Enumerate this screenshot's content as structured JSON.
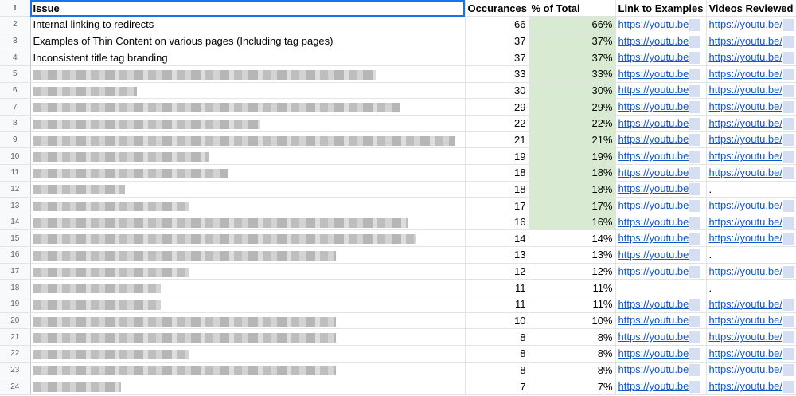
{
  "sheet": {
    "row_numbers": [
      "1",
      "2",
      "3",
      "4",
      "5",
      "6",
      "7",
      "8",
      "9",
      "10",
      "11",
      "12",
      "13",
      "14",
      "15",
      "16",
      "17",
      "18",
      "19",
      "20",
      "21",
      "22",
      "23",
      "24"
    ],
    "headers": {
      "issue": "Issue",
      "occurances": "Occurances",
      "pct": "% of Total",
      "examples": "Link to Examples",
      "videos": "Videos Reviewed"
    },
    "rows": [
      {
        "issue": "Internal linking to redirects",
        "occ": "66",
        "pct": "66%",
        "ex": "https://youtu.be",
        "vid": "https://youtu.be/"
      },
      {
        "issue": "Examples of Thin Content on various pages (Including tag pages)",
        "occ": "37",
        "pct": "37%",
        "ex": "https://youtu.be",
        "vid": "https://youtu.be/"
      },
      {
        "issue": "Inconsistent title tag branding",
        "occ": "37",
        "pct": "37%",
        "ex": "https://youtu.be",
        "vid": "https://youtu.be/"
      },
      {
        "issue": "",
        "occ": "33",
        "pct": "33%",
        "ex": "https://youtu.be",
        "vid": "https://youtu.be/"
      },
      {
        "issue": "",
        "occ": "30",
        "pct": "30%",
        "ex": "https://youtu.be",
        "vid": "https://youtu.be/"
      },
      {
        "issue": "",
        "occ": "29",
        "pct": "29%",
        "ex": "https://youtu.be",
        "vid": "https://youtu.be/"
      },
      {
        "issue": "",
        "occ": "22",
        "pct": "22%",
        "ex": "https://youtu.be",
        "vid": "https://youtu.be/"
      },
      {
        "issue": "",
        "occ": "21",
        "pct": "21%",
        "ex": "https://youtu.be",
        "vid": "https://youtu.be/"
      },
      {
        "issue": "",
        "occ": "19",
        "pct": "19%",
        "ex": "https://youtu.be",
        "vid": "https://youtu.be/"
      },
      {
        "issue": "",
        "occ": "18",
        "pct": "18%",
        "ex": "https://youtu.be",
        "vid": "https://youtu.be/"
      },
      {
        "issue": "",
        "occ": "18",
        "pct": "18%",
        "ex": "https://youtu.be",
        "vid": "."
      },
      {
        "issue": "",
        "occ": "17",
        "pct": "17%",
        "ex": "https://youtu.be",
        "vid": "https://youtu.be/"
      },
      {
        "issue": "",
        "occ": "16",
        "pct": "16%",
        "ex": "https://youtu.be",
        "vid": "https://youtu.be/"
      },
      {
        "issue": "",
        "occ": "14",
        "pct": "14%",
        "ex": "https://youtu.be",
        "vid": "https://youtu.be/"
      },
      {
        "issue": "",
        "occ": "13",
        "pct": "13%",
        "ex": "https://youtu.be",
        "vid": "."
      },
      {
        "issue": "",
        "occ": "12",
        "pct": "12%",
        "ex": "https://youtu.be",
        "vid": "https://youtu.be/"
      },
      {
        "issue": "",
        "occ": "11",
        "pct": "11%",
        "ex": "",
        "vid": "."
      },
      {
        "issue": "",
        "occ": "11",
        "pct": "11%",
        "ex": "https://youtu.be",
        "vid": "https://youtu.be/"
      },
      {
        "issue": "",
        "occ": "10",
        "pct": "10%",
        "ex": "https://youtu.be",
        "vid": "https://youtu.be/"
      },
      {
        "issue": "",
        "occ": "8",
        "pct": "8%",
        "ex": "https://youtu.be",
        "vid": "https://youtu.be/"
      },
      {
        "issue": "",
        "occ": "8",
        "pct": "8%",
        "ex": "https://youtu.be",
        "vid": "https://youtu.be/"
      },
      {
        "issue": "",
        "occ": "8",
        "pct": "8%",
        "ex": "https://youtu.be",
        "vid": "https://youtu.be/"
      },
      {
        "issue": "",
        "occ": "7",
        "pct": "7%",
        "ex": "https://youtu.be",
        "vid": "https://youtu.be/"
      }
    ],
    "highlight_color": "#d9ead3",
    "link_color": "#1155cc"
  }
}
